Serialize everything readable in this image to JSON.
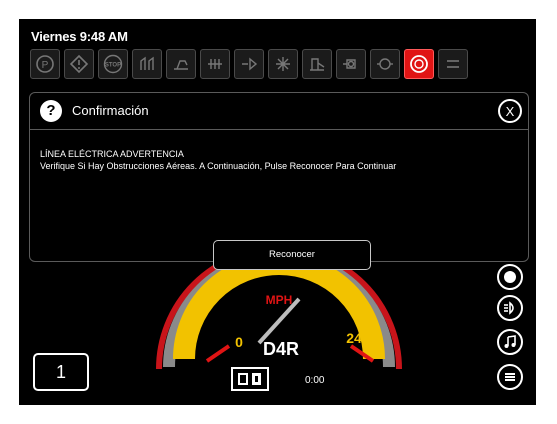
{
  "status_bar": {
    "time": "Viernes 9:48 AM"
  },
  "indicators": [
    {
      "name": "parking-brake-icon",
      "active": false
    },
    {
      "name": "warning-icon",
      "active": false
    },
    {
      "name": "stop-icon",
      "active": false,
      "text": "STOP"
    },
    {
      "name": "hydraulic-icon",
      "active": false
    },
    {
      "name": "ripper-icon",
      "active": false
    },
    {
      "name": "transmission-icon",
      "active": false
    },
    {
      "name": "implement-icon",
      "active": false
    },
    {
      "name": "cooling-icon",
      "active": false
    },
    {
      "name": "blade-icon",
      "active": false
    },
    {
      "name": "engine-icon",
      "active": false
    },
    {
      "name": "oil-icon",
      "active": false
    },
    {
      "name": "powerline-alert-icon",
      "active": true
    },
    {
      "name": "menu-icon",
      "active": false
    }
  ],
  "dialog": {
    "title": "Confirmación",
    "close_label": "X",
    "message_title": "LÍNEA ELÉCTRICA ADVERTENCIA",
    "message_body": "Verifique Si Hay Obstrucciones Aéreas. A Continuación, Pulse Reconocer Para Continuar",
    "ack_label": "Reconocer"
  },
  "gauge": {
    "unit": "MPH",
    "min_label": "0",
    "max_label": "24",
    "speed_fraction": 0.18
  },
  "gear": {
    "selected": "1",
    "direction": "D4R"
  },
  "timer": "0:00",
  "colors": {
    "accent_yellow": "#f2c200",
    "alert_red": "#e01414",
    "text": "#ffffff"
  }
}
